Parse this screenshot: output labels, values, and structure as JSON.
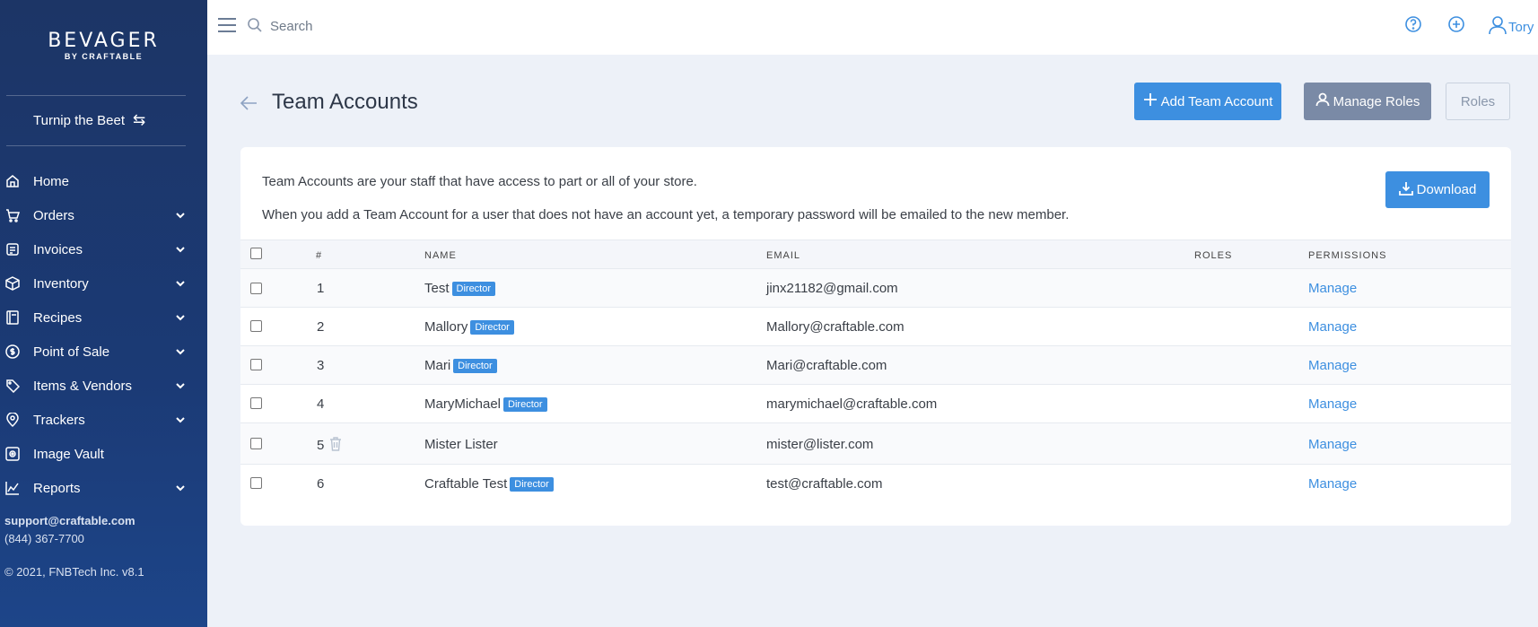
{
  "brand": {
    "name": "BEVAGER",
    "tagline": "BY CRAFTABLE"
  },
  "store": {
    "name": "Turnip the Beet",
    "swap_icon": "swap-icon"
  },
  "sidebar": {
    "items": [
      {
        "label": "Home",
        "icon": "home-icon",
        "has_submenu": false
      },
      {
        "label": "Orders",
        "icon": "cart-icon",
        "has_submenu": true
      },
      {
        "label": "Invoices",
        "icon": "invoice-icon",
        "has_submenu": true
      },
      {
        "label": "Inventory",
        "icon": "box-icon",
        "has_submenu": true
      },
      {
        "label": "Recipes",
        "icon": "book-icon",
        "has_submenu": true
      },
      {
        "label": "Point of Sale",
        "icon": "dollar-icon",
        "has_submenu": true
      },
      {
        "label": "Items & Vendors",
        "icon": "tag-icon",
        "has_submenu": true
      },
      {
        "label": "Trackers",
        "icon": "pin-icon",
        "has_submenu": true
      },
      {
        "label": "Image Vault",
        "icon": "image-icon",
        "has_submenu": false
      },
      {
        "label": "Reports",
        "icon": "chart-icon",
        "has_submenu": true
      }
    ],
    "support_email": "support@craftable.com",
    "support_phone": "(844) 367-7700",
    "copyright": "© 2021, FNBTech Inc. v8.1"
  },
  "topbar": {
    "search_placeholder": "Search",
    "user_name": "Tory"
  },
  "page": {
    "title": "Team Accounts",
    "add_button": "Add Team Account",
    "manage_roles_button": "Manage Roles",
    "roles_button": "Roles",
    "description_1": "Team Accounts are your staff that have access to part or all of your store.",
    "description_2": "When you add a Team Account for a user that does not have an account yet, a temporary password will be emailed to the new member.",
    "download_button": "Download"
  },
  "table": {
    "headers": {
      "num": "#",
      "name": "NAME",
      "email": "EMAIL",
      "roles": "ROLES",
      "permissions": "PERMISSIONS"
    },
    "rows": [
      {
        "num": "1",
        "name": "Test",
        "badge": "Director",
        "email": "jinx21182@gmail.com",
        "permissions": "Manage"
      },
      {
        "num": "2",
        "name": "Mallory",
        "badge": "Director",
        "email": "Mallory@craftable.com",
        "permissions": "Manage"
      },
      {
        "num": "3",
        "name": "Mari",
        "badge": "Director",
        "email": "Mari@craftable.com",
        "permissions": "Manage"
      },
      {
        "num": "4",
        "name": "MaryMichael",
        "badge": "Director",
        "email": "marymichael@craftable.com",
        "permissions": "Manage"
      },
      {
        "num": "5",
        "name": "Mister Lister",
        "badge": "",
        "email": "mister@lister.com",
        "permissions": "Manage"
      },
      {
        "num": "6",
        "name": "Craftable Test",
        "badge": "Director",
        "email": "test@craftable.com",
        "permissions": "Manage"
      }
    ]
  },
  "colors": {
    "accent": "#3d8fe0",
    "sidebar": "#1c3566",
    "secondary_button": "#7a8aa6"
  }
}
